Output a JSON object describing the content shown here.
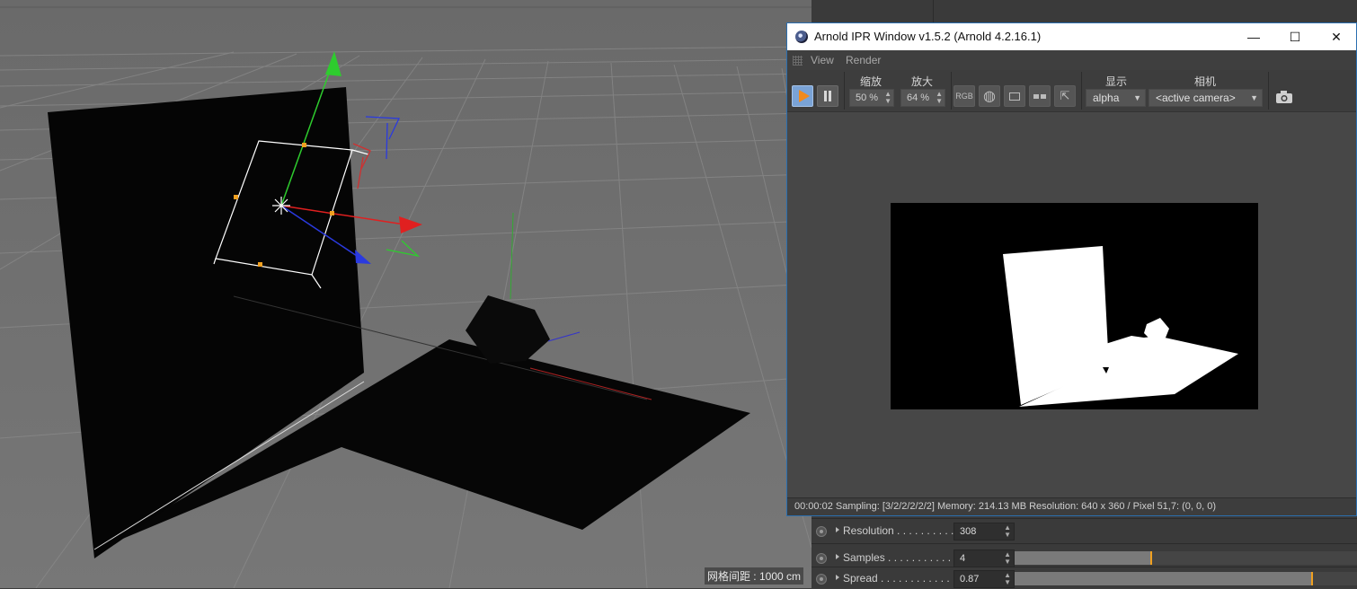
{
  "viewport": {
    "grid_label": "网格间距 : 1000 cm"
  },
  "ipr": {
    "title": "Arnold IPR Window v1.5.2 (Arnold 4.2.16.1)",
    "menu": [
      "View",
      "Render"
    ],
    "toolbar": {
      "zoom_out_label": "缩放",
      "zoom_out_value": "50 %",
      "zoom_in_label": "放大",
      "zoom_in_value": "64 %",
      "rgb_label": "RGB",
      "display_label": "显示",
      "display_value": "alpha",
      "camera_label": "相机",
      "camera_value": "<active camera>"
    },
    "status": "00:00:02  Sampling: [3/2/2/2/2/2]  Memory: 214.13 MB  Resolution: 640 x 360 / Pixel 51,7: (0, 0, 0)",
    "icons": {
      "app": "cinema4d-logo-icon",
      "play": "play-icon",
      "pause": "pause-icon",
      "globe": "globe-icon",
      "region": "region-icon",
      "compare": "compare-icon",
      "export": "export-icon",
      "snapshot": "camera-icon"
    },
    "accent": "#f08a1e"
  },
  "attributes": [
    {
      "label": "Resolution . . . . . . . . . .",
      "value": "308",
      "fill": null,
      "mark": null
    },
    {
      "label": "Samples . . . . . . . . . . . .",
      "value": "4",
      "fill": 0.4,
      "mark": 0.4
    },
    {
      "label": "Spread . . . . . . . . . . . .",
      "value": "0.87",
      "fill": 0.87,
      "mark": 0.87
    }
  ]
}
